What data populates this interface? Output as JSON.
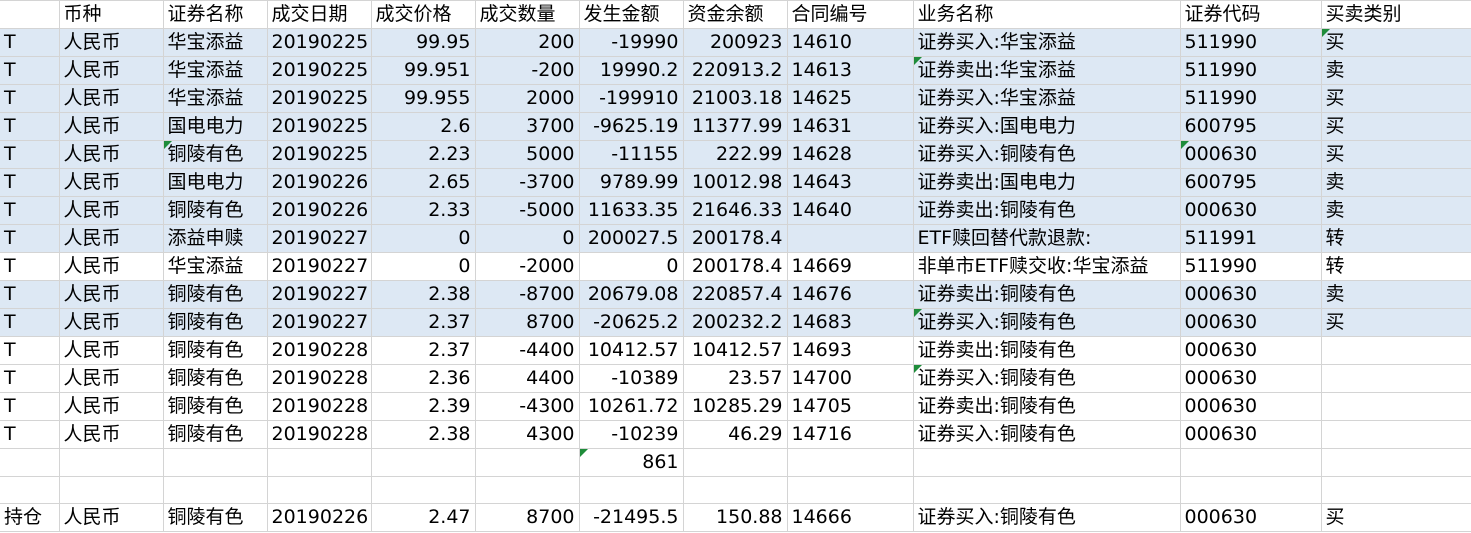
{
  "columns": [
    "",
    "币种",
    "证券名称",
    "成交日期",
    "成交价格",
    "成交数量",
    "发生金额",
    "资金余额",
    "合同编号",
    "业务名称",
    "证券代码",
    "买卖类别"
  ],
  "rows": [
    {
      "h": true,
      "c": [
        "T",
        "人民币",
        "华宝添益",
        "20190225",
        "99.95",
        "200",
        "-19990",
        "200923",
        "14610",
        "证券买入:华宝添益",
        "511990",
        "买"
      ],
      "tri": [
        11
      ]
    },
    {
      "h": true,
      "c": [
        "T",
        "人民币",
        "华宝添益",
        "20190225",
        "99.951",
        "-200",
        "19990.2",
        "220913.2",
        "14613",
        "证券卖出:华宝添益",
        "511990",
        "卖"
      ],
      "tri": [
        9
      ]
    },
    {
      "h": true,
      "c": [
        "T",
        "人民币",
        "华宝添益",
        "20190225",
        "99.955",
        "2000",
        "-199910",
        "21003.18",
        "14625",
        "证券买入:华宝添益",
        "511990",
        "买"
      ],
      "tri": []
    },
    {
      "h": true,
      "c": [
        "T",
        "人民币",
        "国电电力",
        "20190225",
        "2.6",
        "3700",
        "-9625.19",
        "11377.99",
        "14631",
        "证券买入:国电电力",
        "600795",
        "买"
      ],
      "tri": []
    },
    {
      "h": true,
      "c": [
        "T",
        "人民币",
        "铜陵有色",
        "20190225",
        "2.23",
        "5000",
        "-11155",
        "222.99",
        "14628",
        "证券买入:铜陵有色",
        "000630",
        "买"
      ],
      "tri": [
        2,
        10
      ]
    },
    {
      "h": true,
      "c": [
        "T",
        "人民币",
        "国电电力",
        "20190226",
        "2.65",
        "-3700",
        "9789.99",
        "10012.98",
        "14643",
        "证券卖出:国电电力",
        "600795",
        "卖"
      ],
      "tri": []
    },
    {
      "h": true,
      "c": [
        "T",
        "人民币",
        "铜陵有色",
        "20190226",
        "2.33",
        "-5000",
        "11633.35",
        "21646.33",
        "14640",
        "证券卖出:铜陵有色",
        "000630",
        "卖"
      ],
      "tri": []
    },
    {
      "h": true,
      "c": [
        "T",
        "人民币",
        "添益申赎",
        "20190227",
        "0",
        "0",
        "200027.5",
        "200178.4",
        "",
        "ETF赎回替代款退款:",
        "511991",
        "转"
      ],
      "tri": []
    },
    {
      "h": false,
      "c": [
        "T",
        "人民币",
        "华宝添益",
        "20190227",
        "0",
        "-2000",
        "0",
        "200178.4",
        "14669",
        "非单市ETF赎交收:华宝添益",
        "511990",
        "转"
      ],
      "tri": []
    },
    {
      "h": true,
      "c": [
        "T",
        "人民币",
        "铜陵有色",
        "20190227",
        "2.38",
        "-8700",
        "20679.08",
        "220857.4",
        "14676",
        "证券卖出:铜陵有色",
        "000630",
        "卖"
      ],
      "tri": []
    },
    {
      "h": true,
      "c": [
        "T",
        "人民币",
        "铜陵有色",
        "20190227",
        "2.37",
        "8700",
        "-20625.2",
        "200232.2",
        "14683",
        "证券买入:铜陵有色",
        "000630",
        "买"
      ],
      "tri": [
        9
      ]
    },
    {
      "h": false,
      "c": [
        "T",
        "人民币",
        "铜陵有色",
        "20190228",
        "2.37",
        "-4400",
        "10412.57",
        "10412.57",
        "14693",
        "证券卖出:铜陵有色",
        "000630",
        ""
      ],
      "tri": []
    },
    {
      "h": false,
      "c": [
        "T",
        "人民币",
        "铜陵有色",
        "20190228",
        "2.36",
        "4400",
        "-10389",
        "23.57",
        "14700",
        "证券买入:铜陵有色",
        "000630",
        ""
      ],
      "tri": [
        9
      ]
    },
    {
      "h": false,
      "c": [
        "T",
        "人民币",
        "铜陵有色",
        "20190228",
        "2.39",
        "-4300",
        "10261.72",
        "10285.29",
        "14705",
        "证券卖出:铜陵有色",
        "000630",
        ""
      ],
      "tri": []
    },
    {
      "h": false,
      "c": [
        "T",
        "人民币",
        "铜陵有色",
        "20190228",
        "2.38",
        "4300",
        "-10239",
        "46.29",
        "14716",
        "证券买入:铜陵有色",
        "000630",
        ""
      ],
      "tri": []
    },
    {
      "h": false,
      "c": [
        "",
        "",
        "",
        "",
        "",
        "",
        "861",
        "",
        "",
        "",
        "",
        ""
      ],
      "tri": [
        6
      ]
    },
    {
      "h": false,
      "c": [
        "",
        "",
        "",
        "",
        "",
        "",
        "",
        "",
        "",
        "",
        "",
        ""
      ],
      "tri": []
    },
    {
      "h": false,
      "c": [
        "持仓",
        "人民币",
        "铜陵有色",
        "20190226",
        "2.47",
        "8700",
        "-21495.5",
        "150.88",
        "14666",
        "证券买入:铜陵有色",
        "000630",
        "买"
      ],
      "tri": []
    }
  ]
}
